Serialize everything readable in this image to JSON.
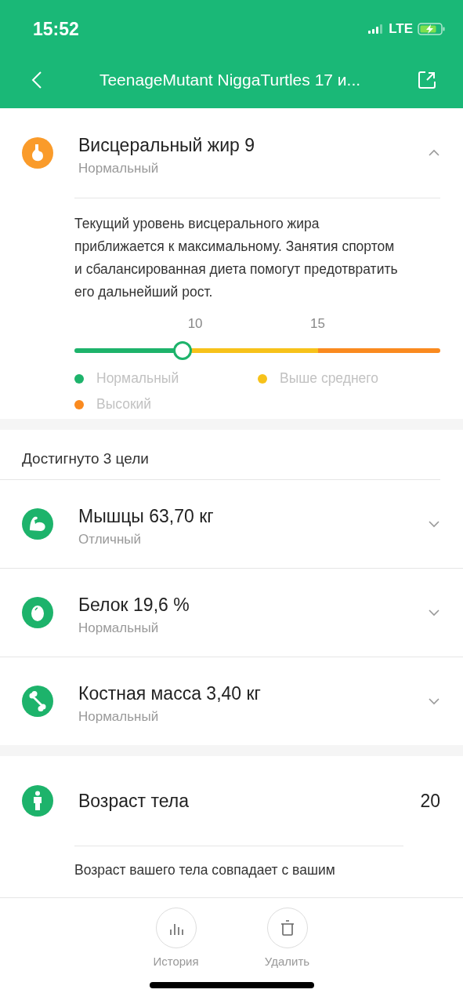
{
  "status_bar": {
    "time": "15:52",
    "network": "LTE"
  },
  "header": {
    "title": "TeenageMutant NiggaTurtles 17 и..."
  },
  "visceral": {
    "title": "Висцеральный жир 9",
    "status": "Нормальный",
    "expanded": true,
    "description": "Текущий уровень висцерального жира приближается к максимальному. Занятия спортом и сбалансированная диета помогут предотвратить его дальнейший рост.",
    "ticks": [
      "10",
      "15"
    ],
    "level": 0.296,
    "legend": [
      {
        "label": "Нормальный",
        "color": "#1db36b"
      },
      {
        "label": "Выше среднего",
        "color": "#f7c21a"
      },
      {
        "label": "Высокий",
        "color": "#fa8a1f"
      }
    ]
  },
  "goals": {
    "title": "Достигнуто 3 цели",
    "items": [
      {
        "kind": "muscle",
        "title": "Мышцы 63,70 кг",
        "status": "Отличный",
        "expanded": false
      },
      {
        "kind": "protein",
        "title": "Белок 19,6 %",
        "status": "Нормальный",
        "expanded": false
      },
      {
        "kind": "bone",
        "title": "Костная масса 3,40 кг",
        "status": "Нормальный",
        "expanded": false
      }
    ]
  },
  "body_age": {
    "title": "Возраст тела",
    "value": "20",
    "description": "Возраст вашего тела совпадает с вашим"
  },
  "actions": [
    {
      "kind": "history",
      "label": "История"
    },
    {
      "kind": "delete",
      "label": "Удалить"
    }
  ]
}
